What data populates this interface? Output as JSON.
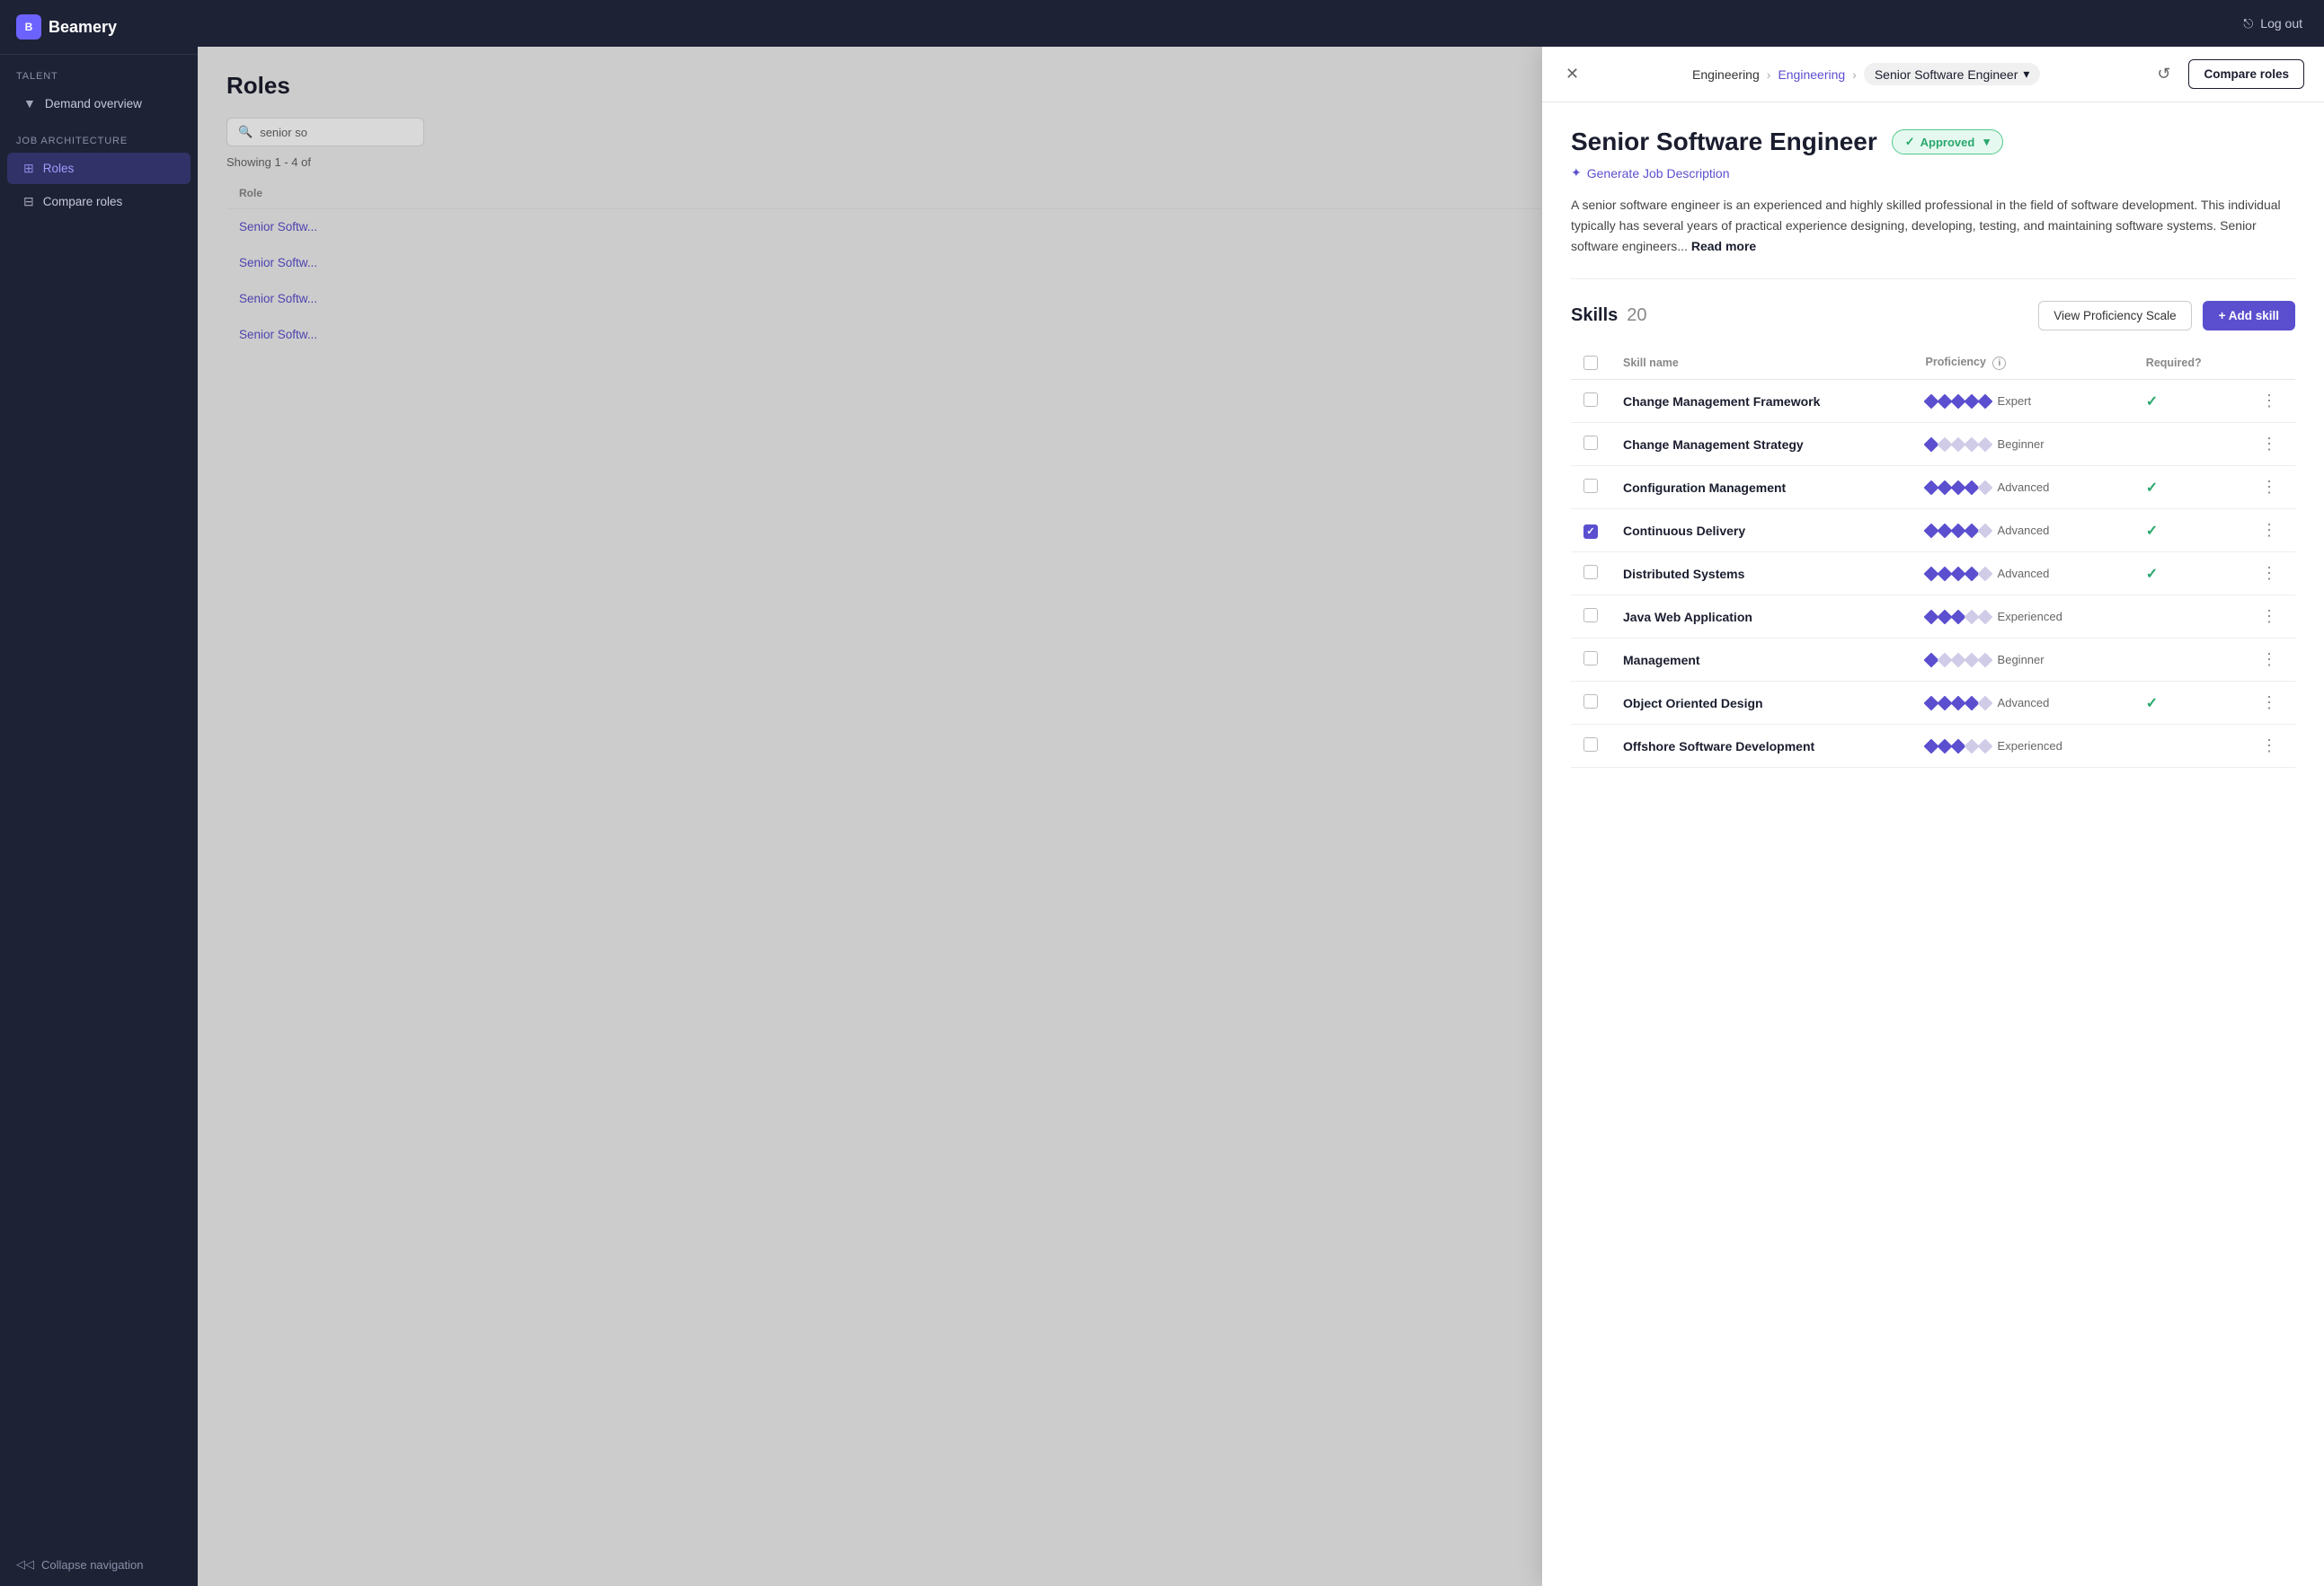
{
  "app": {
    "name": "Beamery",
    "logout_label": "Log out"
  },
  "sidebar": {
    "talent_label": "TALENT",
    "demand_overview_label": "Demand overview",
    "job_architecture_label": "JOB ARCHITECTURE",
    "roles_label": "Roles",
    "compare_roles_label": "Compare roles",
    "collapse_label": "Collapse navigation"
  },
  "roles_page": {
    "title": "Roles",
    "search_placeholder": "senior so",
    "showing_text": "Showing 1 - 4 of",
    "table": {
      "column": "Role",
      "rows": [
        "Senior Softw...",
        "Senior Softw...",
        "Senior Softw...",
        "Senior Softw..."
      ]
    }
  },
  "panel": {
    "breadcrumb_root": "Engineering",
    "breadcrumb_mid": "Engineering",
    "breadcrumb_current": "Senior Software Engineer",
    "compare_roles_btn": "Compare roles",
    "close_btn": "×",
    "role_title": "Senior Software Engineer",
    "status_badge": "Approved",
    "generate_link": "Generate Job Description",
    "description": "A senior software engineer is an experienced and highly skilled professional in the field of software development. This individual typically has several years of practical experience designing, developing, testing, and maintaining software systems. Senior software engineers...",
    "read_more": "Read more",
    "skills_label": "Skills",
    "skills_count": "20",
    "view_proficiency_btn": "View Proficiency Scale",
    "add_skill_btn": "+ Add skill",
    "table": {
      "col_checkbox": "",
      "col_skill_name": "Skill name",
      "col_proficiency": "Proficiency",
      "col_required": "Required?",
      "skills": [
        {
          "name": "Change Management Framework",
          "proficiency_filled": 5,
          "proficiency_total": 5,
          "proficiency_label": "Expert",
          "required": true,
          "checked": false
        },
        {
          "name": "Change Management Strategy",
          "proficiency_filled": 1,
          "proficiency_total": 5,
          "proficiency_label": "Beginner",
          "required": false,
          "checked": false
        },
        {
          "name": "Configuration Management",
          "proficiency_filled": 4,
          "proficiency_total": 5,
          "proficiency_label": "Advanced",
          "required": true,
          "checked": false
        },
        {
          "name": "Continuous Delivery",
          "proficiency_filled": 4,
          "proficiency_total": 5,
          "proficiency_label": "Advanced",
          "required": true,
          "checked": true
        },
        {
          "name": "Distributed Systems",
          "proficiency_filled": 4,
          "proficiency_total": 5,
          "proficiency_label": "Advanced",
          "required": true,
          "checked": false
        },
        {
          "name": "Java Web Application",
          "proficiency_filled": 3,
          "proficiency_total": 5,
          "proficiency_label": "Experienced",
          "required": false,
          "checked": false
        },
        {
          "name": "Management",
          "proficiency_filled": 1,
          "proficiency_total": 5,
          "proficiency_label": "Beginner",
          "required": false,
          "checked": false
        },
        {
          "name": "Object Oriented Design",
          "proficiency_filled": 4,
          "proficiency_total": 5,
          "proficiency_label": "Advanced",
          "required": true,
          "checked": false
        },
        {
          "name": "Offshore Software Development",
          "proficiency_filled": 3,
          "proficiency_total": 5,
          "proficiency_label": "Experienced",
          "required": false,
          "checked": false
        }
      ]
    }
  },
  "colors": {
    "accent": "#5b4fcf",
    "approved_bg": "#e6f9f0",
    "approved_border": "#52c98a",
    "approved_text": "#28a86c"
  }
}
